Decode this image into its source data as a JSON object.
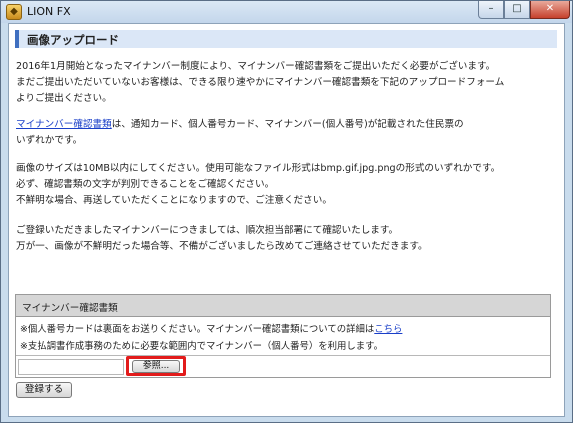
{
  "window": {
    "title": "LION FX",
    "buttons": {
      "minimize": "–",
      "maximize": "□",
      "close": "✕"
    },
    "icon": "lion-app-icon"
  },
  "page": {
    "heading": "画像アップロード",
    "intro": [
      "2016年1月開始となったマイナンバー制度により、マイナンバー確認書類をご提出いただく必要がございます。",
      "まだご提出いただいていないお客様は、できる限り速やかにマイナンバー確認書類を下記のアップロードフォーム",
      "よりご提出ください。"
    ],
    "doc_link": "マイナンバー確認書類",
    "doc_desc_1": "は、通知カード、個人番号カード、マイナンバー(個人番号)が記載された住民票の",
    "doc_desc_2": "いずれかです。",
    "rules": [
      "画像のサイズは10MB以内にしてください。使用可能なファイル形式はbmp.gif.jpg.pngの形式のいずれかです。",
      "必ず、確認書類の文字が判別できることをご確認ください。",
      "不鮮明な場合、再送していただくことになりますので、ご注意ください。"
    ],
    "closing": [
      "ご登録いただきましたマイナンバーにつきましては、順次担当部署にて確認いたします。",
      "万が一、画像が不鮮明だった場合等、不備がございましたら改めてご連絡させていただきます。"
    ]
  },
  "upload_panel": {
    "title": "マイナンバー確認書類",
    "note1_prefix": "※個人番号カードは裏面をお送りください。マイナンバー確認書類についての詳細は",
    "note1_link": "こちら",
    "note2": "※支払調書作成事務のために必要な範囲内でマイナンバー（個人番号）を利用します。",
    "file_value": "",
    "browse_label": "参照..."
  },
  "register_label": "登録する"
}
